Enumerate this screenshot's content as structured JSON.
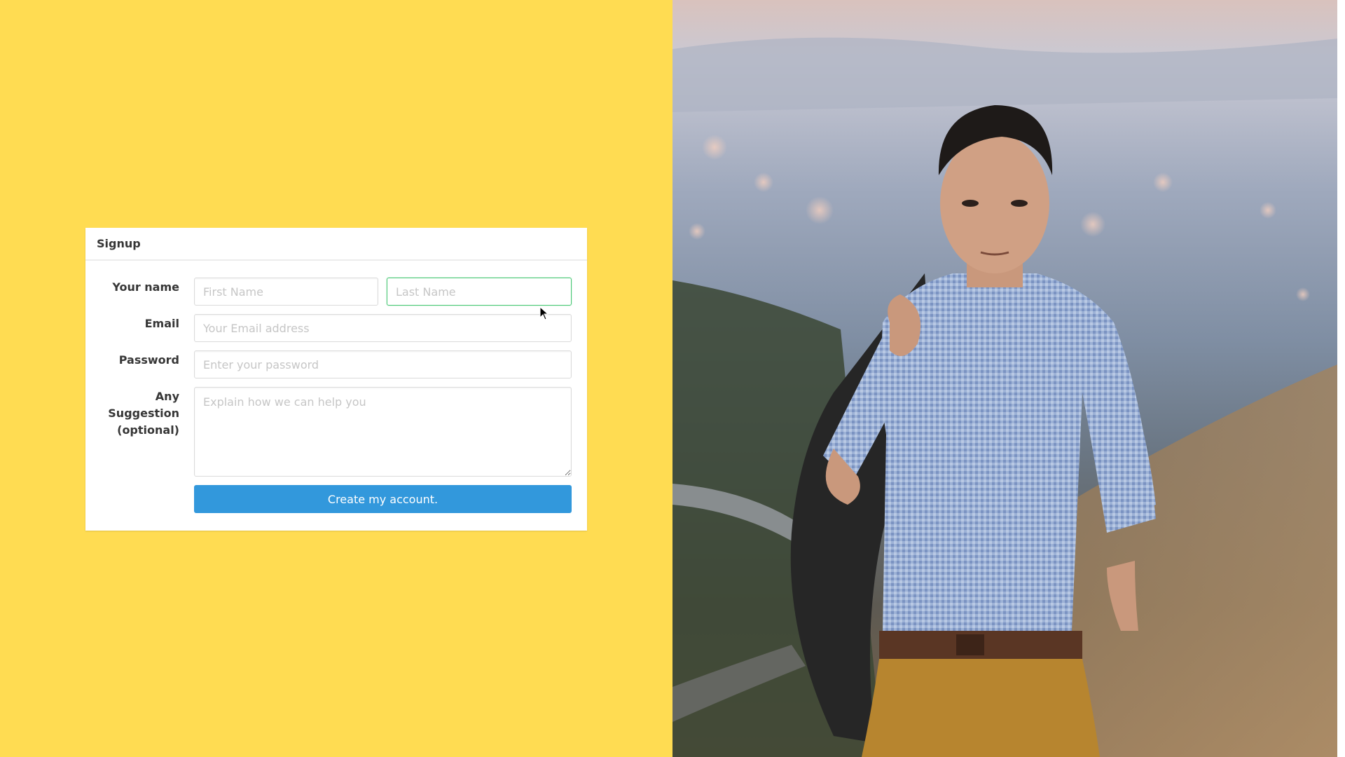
{
  "form": {
    "title": "Signup",
    "name_label": "Your name",
    "first_name_placeholder": "First Name",
    "last_name_placeholder": "Last Name",
    "email_label": "Email",
    "email_placeholder": "Your Email address",
    "password_label": "Password",
    "password_placeholder": "Enter your password",
    "suggestion_label": "Any Suggestion (optional)",
    "suggestion_placeholder": "Explain how we can help you",
    "submit_label": "Create my account."
  },
  "colors": {
    "left_background": "#ffdc52",
    "accent_button": "#3298dc",
    "focus_border": "#48c774"
  },
  "photo": {
    "alt": "Portrait photograph of a man in a checked shirt holding a jacket over his shoulder, hillside and city view behind"
  }
}
